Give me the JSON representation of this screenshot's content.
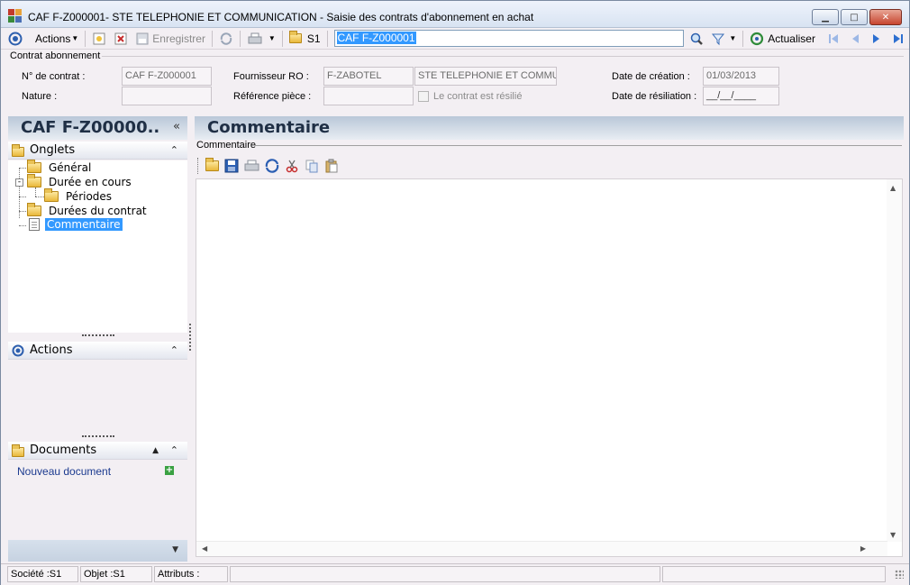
{
  "window": {
    "title": "CAF F-Z000001- STE TELEPHONIE ET COMMUNICATION -  Saisie des contrats d'abonnement en achat",
    "minimize_label": "▁",
    "maximize_label": "□",
    "close_label": "✕"
  },
  "toolbar": {
    "actions_label": "Actions",
    "save_label": "Enregistrer",
    "company_label": "S1",
    "search_value": "CAF F-Z000001",
    "refresh_label": "Actualiser"
  },
  "header": {
    "group_label": "Contrat abonnement",
    "contract_no_label": "N° de contrat :",
    "contract_no_value": "CAF F-Z000001",
    "nature_label": "Nature :",
    "nature_value": "",
    "supplier_label": "Fournisseur RO :",
    "supplier_code": "F-ZABOTEL",
    "supplier_name": "STE TELEPHONIE ET COMMU",
    "piece_ref_label": "Référence pièce :",
    "piece_ref_value": "",
    "terminated_label": "Le contrat  est résilié",
    "creation_date_label": "Date de création :",
    "creation_date_value": "01/03/2013",
    "termination_date_label": "Date de résiliation :",
    "termination_date_value": "__/__/____"
  },
  "left_panel": {
    "title": "CAF F-Z00000..",
    "collapse_label": "«",
    "onglets_label": "Onglets",
    "tree": [
      {
        "label": "Général"
      },
      {
        "label": "Durée en cours"
      },
      {
        "label": "Périodes"
      },
      {
        "label": "Durées du contrat"
      },
      {
        "label": "Commentaire"
      }
    ],
    "actions_label": "Actions",
    "documents_label": "Documents",
    "new_document_label": "Nouveau document"
  },
  "content": {
    "title": "Commentaire",
    "group_label": "Commentaire",
    "text": ""
  },
  "statusbar": {
    "company": "Société :S1",
    "object": "Objet :S1",
    "attributes": "Attributs :"
  },
  "colors": {
    "selection": "#3399ff",
    "panel_header": "#b9c7d8",
    "link": "#1b3a8f"
  }
}
